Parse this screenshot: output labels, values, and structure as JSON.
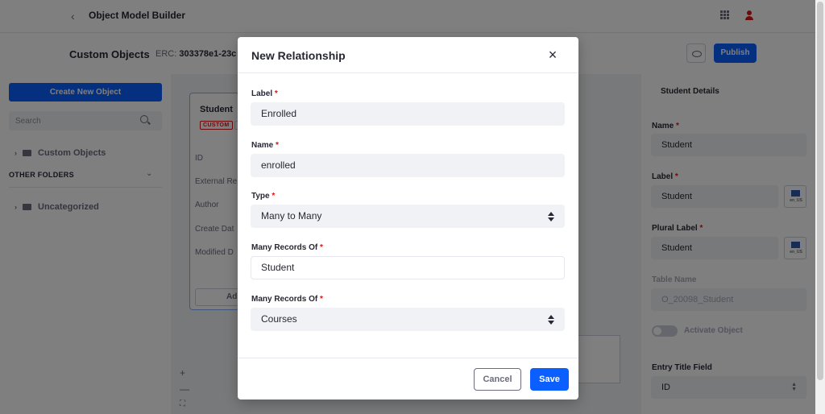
{
  "topbar": {
    "title": "Object Model Builder"
  },
  "subbar": {
    "page_title": "Custom Objects",
    "erc_label": "ERC:",
    "erc_value": "303378e1-23c",
    "publish_label": "Publish"
  },
  "left_panel": {
    "create_label": "Create New Object",
    "search_placeholder": "Search",
    "tree": {
      "custom_objects": "Custom Objects",
      "other_folders": "OTHER FOLDERS",
      "uncategorized": "Uncategorized"
    }
  },
  "canvas": {
    "card": {
      "title": "Student",
      "badge": "CUSTOM",
      "fields": [
        "ID",
        "External Re",
        "Author",
        "Create Dat",
        "Modified D"
      ],
      "add_label": "Ad"
    },
    "zoom": {
      "in": "+",
      "out": "—",
      "fit": "⛶"
    }
  },
  "right_panel": {
    "title": "Student Details",
    "name_label": "Name",
    "name_value": "Student",
    "label_label": "Label",
    "label_value": "Student",
    "plural_label": "Plural Label",
    "plural_value": "Student",
    "locale_code": "en_US",
    "table_name_label": "Table Name",
    "table_name_value": "O_20098_Student",
    "activate_label": "Activate Object",
    "entry_title_label": "Entry Title Field",
    "entry_title_value": "ID"
  },
  "modal": {
    "title": "New Relationship",
    "close_icon": "×",
    "required_mark": "*",
    "label_field": {
      "label": "Label",
      "value": "Enrolled"
    },
    "name_field": {
      "label": "Name",
      "value": "enrolled"
    },
    "type_field": {
      "label": "Type",
      "value": "Many to Many"
    },
    "many_records_1": {
      "label": "Many Records Of",
      "value": "Student"
    },
    "many_records_2": {
      "label": "Many Records Of",
      "value": "Courses"
    },
    "cancel_label": "Cancel",
    "save_label": "Save"
  },
  "colors": {
    "primary": "#0b5fff",
    "required": "#da1414",
    "overlay": "rgba(0,0,0,0.5)"
  }
}
